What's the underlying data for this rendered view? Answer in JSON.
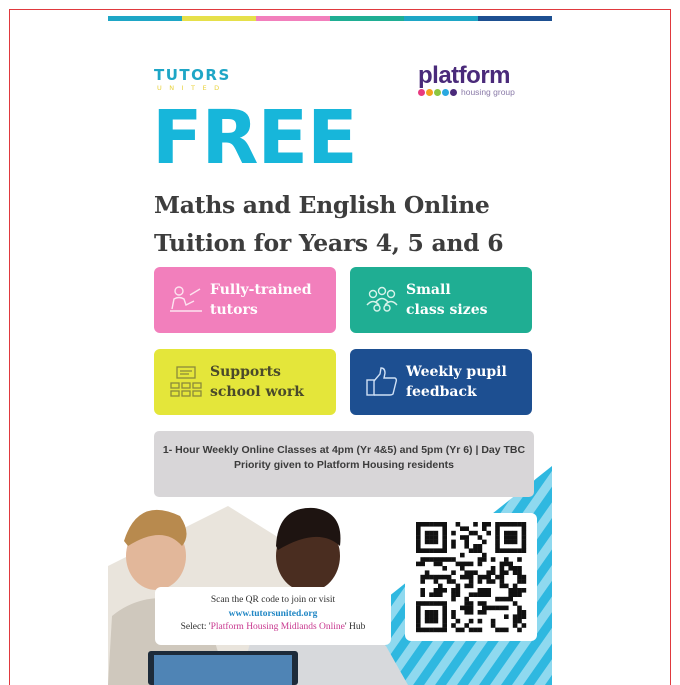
{
  "colors": {
    "topbar": [
      "#1ea6c6",
      "#e6e04a",
      "#f27fbc",
      "#1fae93",
      "#1ea6c6",
      "#1d4f91"
    ],
    "free": "#17b6da",
    "pink": "#f27fbc",
    "teal": "#1fae93",
    "yellow": "#e4e63a",
    "navy": "#1d4f91",
    "frame": "#e0393e"
  },
  "logos": {
    "tutors_line1": "TUTORS",
    "tutors_line2": "UNITED",
    "platform_name": "platform",
    "platform_sub": "housing group"
  },
  "headline": {
    "free": "FREE",
    "line1": "Maths and English Online",
    "line2": "Tuition for Years 4, 5 and 6"
  },
  "features": [
    {
      "line1": "Fully-trained",
      "line2": "tutors",
      "icon": "tutor-at-desk-icon"
    },
    {
      "line1": "Small",
      "line2": "class sizes",
      "icon": "group-of-people-icon"
    },
    {
      "line1": "Supports",
      "line2": "school work",
      "icon": "classroom-icon"
    },
    {
      "line1": "Weekly pupil",
      "line2": "feedback",
      "icon": "thumbs-up-icon"
    }
  ],
  "info": {
    "line1": "1- Hour Weekly Online Classes at 4pm (Yr 4&5) and 5pm (Yr 6) | Day TBC",
    "line2": "Priority given to Platform Housing residents"
  },
  "scan": {
    "line1": "Scan the QR code to join or visit",
    "url": "www.tutorsunited.org",
    "line3_prefix": "Select: '",
    "line3_hub": "Platform Housing Midlands Online",
    "line3_suffix": "' Hub"
  }
}
